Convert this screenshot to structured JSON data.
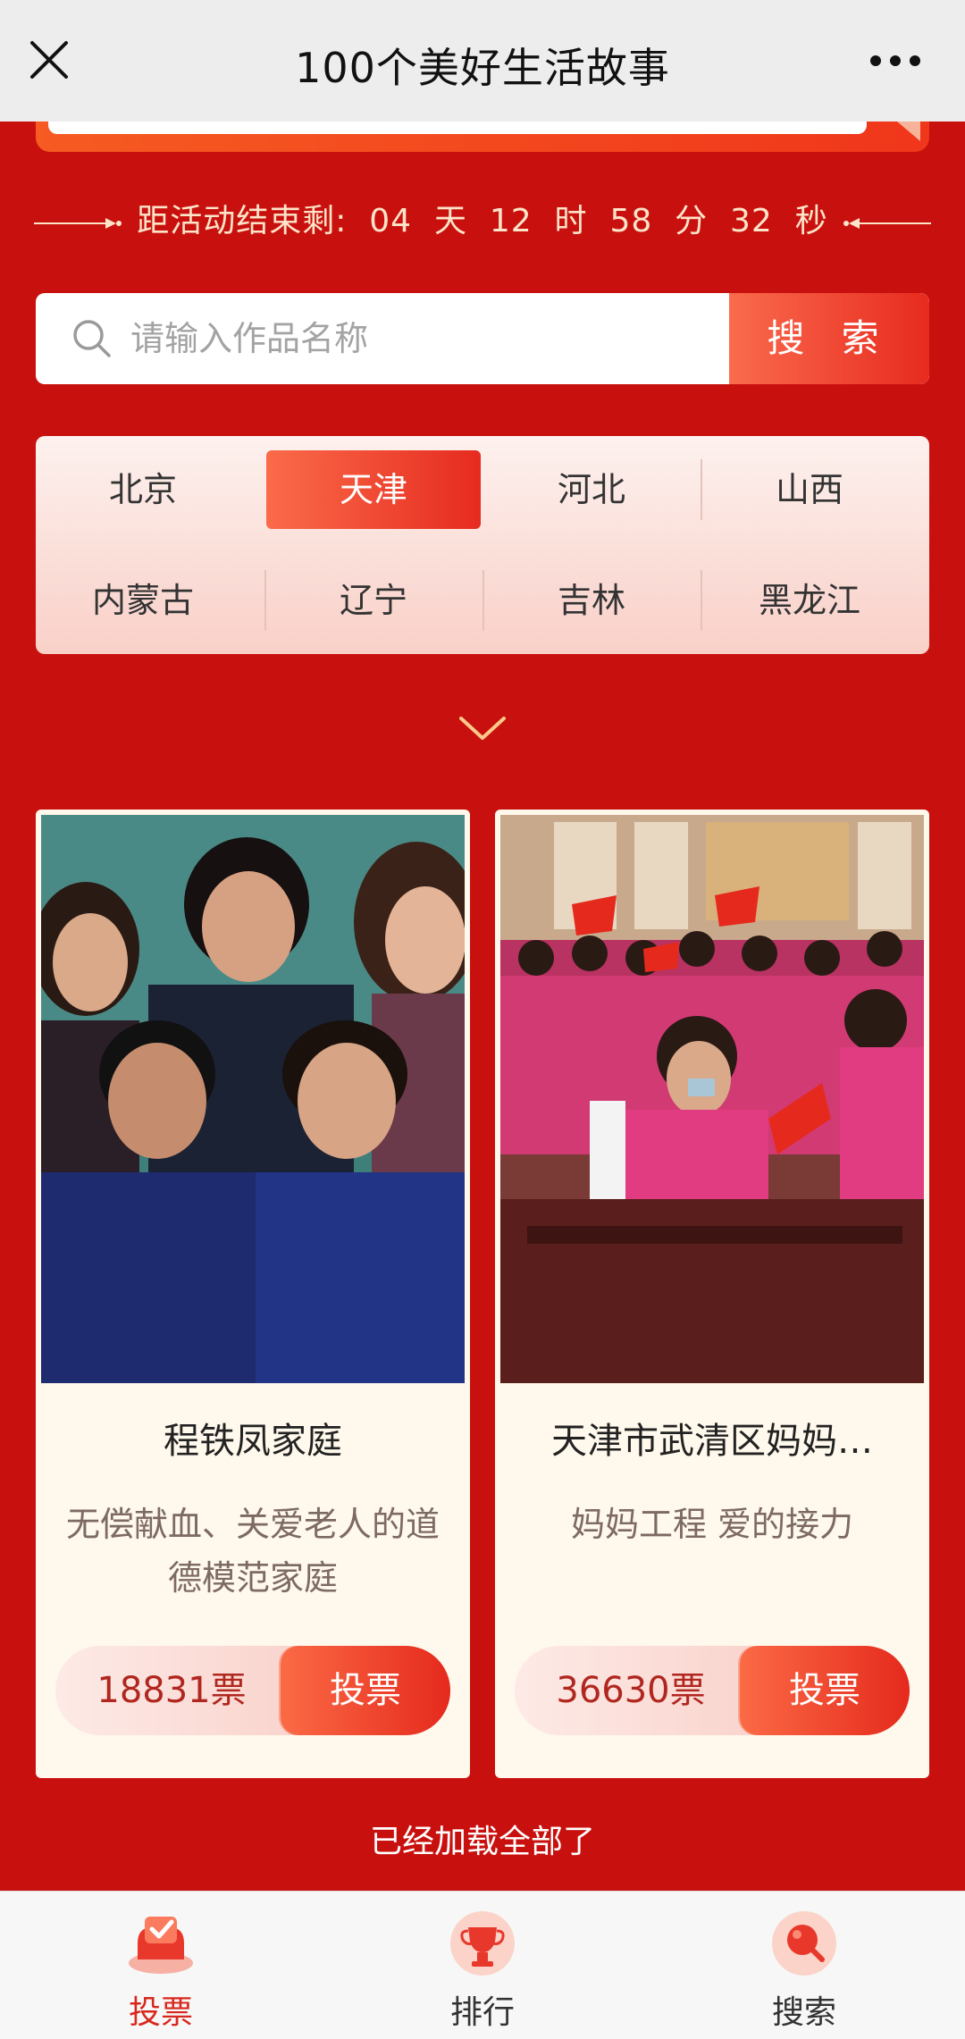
{
  "topbar": {
    "title": "100个美好生活故事",
    "close_icon": "close-icon",
    "more_icon": "more-icon"
  },
  "countdown": {
    "text": "距活动结束剩:  04  天  12  时  58  分  32  秒"
  },
  "search": {
    "placeholder": "请输入作品名称",
    "button_label": "搜 索"
  },
  "regions": {
    "items": [
      "北京",
      "天津",
      "河北",
      "山西",
      "内蒙古",
      "辽宁",
      "吉林",
      "黑龙江"
    ],
    "selected": "天津"
  },
  "cards": [
    {
      "name": "程铁凤家庭",
      "desc": "无偿献血、关爱老人的道德模范家庭",
      "votes": "18831票",
      "vote_label": "投票"
    },
    {
      "name": "天津市武清区妈妈…",
      "desc": "妈妈工程 爱的接力",
      "votes": "36630票",
      "vote_label": "投票"
    }
  ],
  "footer_text": "已经加载全部了",
  "tabs": [
    {
      "label": "投票",
      "icon": "vote-icon",
      "active": true
    },
    {
      "label": "排行",
      "icon": "trophy-icon",
      "active": false
    },
    {
      "label": "搜索",
      "icon": "search-icon",
      "active": false
    }
  ],
  "colors": {
    "background": "#c8110e",
    "accent": "#e72b1f",
    "countdown_text": "#fde4c9"
  }
}
